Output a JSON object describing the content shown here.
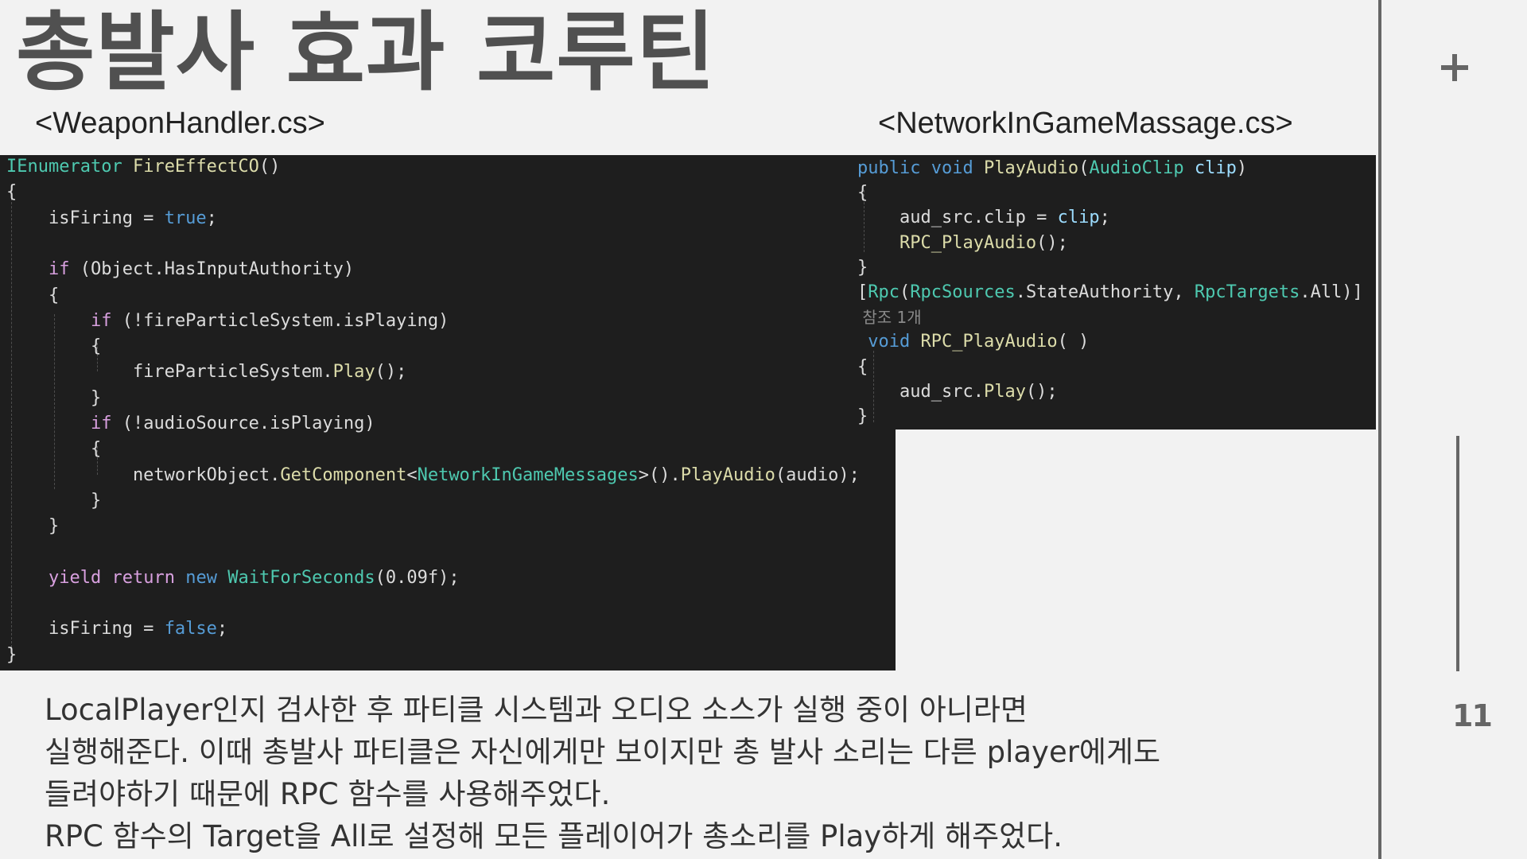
{
  "slide": {
    "title": "총발사 효과 코루틴",
    "page_number": "11"
  },
  "files": {
    "left": "<WeaponHandler.cs>",
    "right": "<NetworkInGameMassage.cs>"
  },
  "code_left": [
    [
      [
        "IEnumerator",
        "ty"
      ],
      [
        " ",
        "pl"
      ],
      [
        "FireEffectCO",
        "fn"
      ],
      [
        "()",
        "pl"
      ]
    ],
    [
      [
        "{",
        "pl"
      ]
    ],
    [
      [
        "    isFiring = ",
        "pl"
      ],
      [
        "true",
        "kw"
      ],
      [
        ";",
        "pl"
      ]
    ],
    [
      [
        "",
        "pl"
      ]
    ],
    [
      [
        "    ",
        "pl"
      ],
      [
        "if",
        "kw2"
      ],
      [
        " (Object.HasInputAuthority)",
        "pl"
      ]
    ],
    [
      [
        "    {",
        "pl"
      ]
    ],
    [
      [
        "        ",
        "pl"
      ],
      [
        "if",
        "kw2"
      ],
      [
        " (!fireParticleSystem.isPlaying)",
        "pl"
      ]
    ],
    [
      [
        "        {",
        "pl"
      ]
    ],
    [
      [
        "            fireParticleSystem.",
        "pl"
      ],
      [
        "Play",
        "fn"
      ],
      [
        "();",
        "pl"
      ]
    ],
    [
      [
        "        }",
        "pl"
      ]
    ],
    [
      [
        "        ",
        "pl"
      ],
      [
        "if",
        "kw2"
      ],
      [
        " (!audioSource.isPlaying)",
        "pl"
      ]
    ],
    [
      [
        "        {",
        "pl"
      ]
    ],
    [
      [
        "            networkObject.",
        "pl"
      ],
      [
        "GetComponent",
        "fn"
      ],
      [
        "<",
        "pl"
      ],
      [
        "NetworkInGameMessages",
        "ty"
      ],
      [
        ">().",
        "pl"
      ],
      [
        "PlayAudio",
        "fn"
      ],
      [
        "(audio);",
        "pl"
      ]
    ],
    [
      [
        "        }",
        "pl"
      ]
    ],
    [
      [
        "    }",
        "pl"
      ]
    ],
    [
      [
        "",
        "pl"
      ]
    ],
    [
      [
        "    ",
        "pl"
      ],
      [
        "yield",
        "kw2"
      ],
      [
        " ",
        "pl"
      ],
      [
        "return",
        "kw2"
      ],
      [
        " ",
        "pl"
      ],
      [
        "new",
        "kw"
      ],
      [
        " ",
        "pl"
      ],
      [
        "WaitForSeconds",
        "ty"
      ],
      [
        "(0.09f);",
        "pl"
      ]
    ],
    [
      [
        "",
        "pl"
      ]
    ],
    [
      [
        "    isFiring = ",
        "pl"
      ],
      [
        "false",
        "kw"
      ],
      [
        ";",
        "pl"
      ]
    ],
    [
      [
        "}",
        "pl"
      ]
    ]
  ],
  "code_right": [
    [
      [
        "public",
        "kw"
      ],
      [
        " ",
        "pl"
      ],
      [
        "void",
        "kw"
      ],
      [
        " ",
        "pl"
      ],
      [
        "PlayAudio",
        "fn"
      ],
      [
        "(",
        "pl"
      ],
      [
        "AudioClip",
        "ty"
      ],
      [
        " ",
        "pl"
      ],
      [
        "clip",
        "param"
      ],
      [
        ")",
        "pl"
      ]
    ],
    [
      [
        "{",
        "pl"
      ]
    ],
    [
      [
        "    aud_src.clip = ",
        "pl"
      ],
      [
        "clip",
        "param"
      ],
      [
        ";",
        "pl"
      ]
    ],
    [
      [
        "    ",
        "pl"
      ],
      [
        "RPC_PlayAudio",
        "fn"
      ],
      [
        "();",
        "pl"
      ]
    ],
    [
      [
        "}",
        "pl"
      ]
    ],
    [
      [
        "[",
        "pl"
      ],
      [
        "Rpc",
        "attr"
      ],
      [
        "(",
        "pl"
      ],
      [
        "RpcSources",
        "ty"
      ],
      [
        ".StateAuthority, ",
        "pl"
      ],
      [
        "RpcTargets",
        "ty"
      ],
      [
        ".All)]",
        "pl"
      ]
    ],
    [
      [
        " 참조 1개",
        "ref"
      ]
    ],
    [
      [
        " ",
        "pl"
      ],
      [
        "void",
        "kw"
      ],
      [
        " ",
        "pl"
      ],
      [
        "RPC_PlayAudio",
        "fn"
      ],
      [
        "( )",
        "pl"
      ]
    ],
    [
      [
        "{",
        "pl"
      ]
    ],
    [
      [
        "    aud_src.",
        "pl"
      ],
      [
        "Play",
        "fn"
      ],
      [
        "();",
        "pl"
      ]
    ],
    [
      [
        "}",
        "pl"
      ]
    ]
  ],
  "description": [
    "LocalPlayer인지 검사한 후 파티클 시스템과 오디오 소스가 실행 중이 아니라면",
    "실행해준다. 이때 총발사 파티클은 자신에게만 보이지만 총 발사 소리는 다른 player에게도",
    "들려야하기 때문에 RPC 함수를 사용해주었다.",
    "RPC 함수의 Target을 All로 설정해 모든 플레이어가 총소리를 Play하게 해주었다."
  ]
}
